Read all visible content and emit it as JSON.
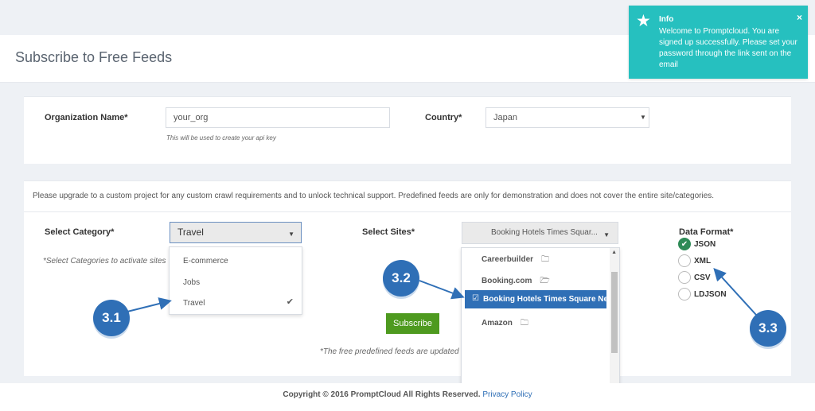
{
  "page_title": "Subscribe to Free Feeds",
  "toast": {
    "title": "Info",
    "message": "Welcome to Promptcloud. You are signed up successfully. Please set your password through the link sent on the email",
    "close": "×"
  },
  "org": {
    "label": "Organization Name*",
    "value": "your_org",
    "hint": "This will be used to create your api key"
  },
  "country": {
    "label": "Country*",
    "value": "Japan"
  },
  "notice": "Please upgrade to a custom project for any custom crawl requirements and to unlock technical support. Predefined feeds are only for demonstration and does not cover the entire site/categories.",
  "category": {
    "label": "Select Category*",
    "value": "Travel",
    "hint": "*Select Categories to activate sites",
    "options": [
      "E-commerce",
      "Jobs",
      "Travel"
    ]
  },
  "sites": {
    "label": "Select Sites*",
    "value": "Booking Hotels Times Squar...",
    "options": [
      "Careerbuilder",
      "Booking.com",
      "Booking Hotels Times Square New",
      "Amazon"
    ]
  },
  "subscribe_label": "Subscribe",
  "free_note": "*The free predefined feeds are updated",
  "format": {
    "label": "Data Format*",
    "options": [
      "JSON",
      "XML",
      "CSV",
      "LDJSON"
    ],
    "selected": "JSON"
  },
  "footer": {
    "copyright": "Copyright © 2016 PromptCloud All Rights Reserved.",
    "privacy": "Privacy Policy"
  },
  "annotations": [
    "3.1",
    "3.2",
    "3.3"
  ],
  "colors": {
    "toast": "#26c0bf",
    "badge": "#2f6fb6",
    "subscribe": "#4e9a1f",
    "selected_site": "#2f6fb6"
  },
  "icons": {
    "toast": "star-icon",
    "folder": "folder-icon",
    "check": "checkmark-icon"
  }
}
